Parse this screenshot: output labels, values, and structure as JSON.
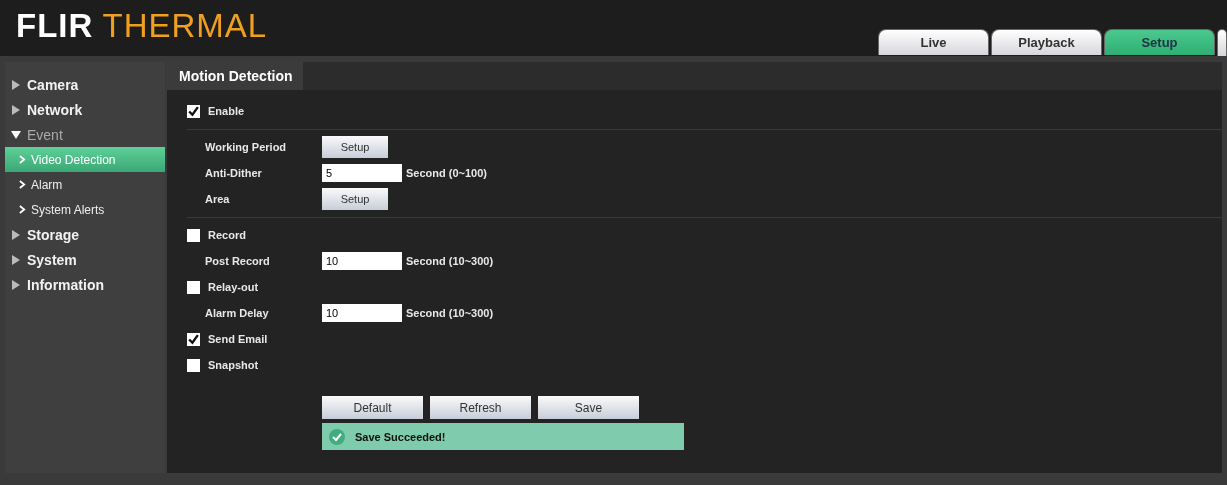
{
  "logo": {
    "bold": "FLIR",
    "light": "THERMAL"
  },
  "tabs": [
    {
      "label": "Live",
      "selected": false
    },
    {
      "label": "Playback",
      "selected": false
    },
    {
      "label": "Setup",
      "selected": true
    }
  ],
  "sidebar": {
    "items": [
      {
        "label": "Camera",
        "expanded": false,
        "selected": false
      },
      {
        "label": "Network",
        "expanded": false,
        "selected": false
      },
      {
        "label": "Event",
        "expanded": true,
        "selected": false,
        "children": [
          {
            "label": "Video Detection",
            "selected": true
          },
          {
            "label": "Alarm",
            "selected": false
          },
          {
            "label": "System Alerts",
            "selected": false
          }
        ]
      },
      {
        "label": "Storage",
        "expanded": false,
        "selected": false
      },
      {
        "label": "System",
        "expanded": false,
        "selected": false
      },
      {
        "label": "Information",
        "expanded": false,
        "selected": false
      }
    ]
  },
  "panel_tab": "Motion Detection",
  "rows": [
    {
      "kind": "checkbox",
      "label": "Enable",
      "checked": true,
      "divider": true
    },
    {
      "kind": "button",
      "label": "Working Period",
      "button": "Setup"
    },
    {
      "kind": "input",
      "label": "Anti-Dither",
      "value": "5",
      "unit": "Second (0~100)"
    },
    {
      "kind": "button",
      "label": "Area",
      "button": "Setup",
      "divider": true
    },
    {
      "kind": "checkbox",
      "label": "Record",
      "checked": false
    },
    {
      "kind": "input",
      "label": "Post Record",
      "value": "10",
      "unit": "Second (10~300)"
    },
    {
      "kind": "checkbox",
      "label": "Relay-out",
      "checked": false
    },
    {
      "kind": "input",
      "label": "Alarm Delay",
      "value": "10",
      "unit": "Second (10~300)"
    },
    {
      "kind": "checkbox",
      "label": "Send Email",
      "checked": true
    },
    {
      "kind": "checkbox",
      "label": "Snapshot",
      "checked": false
    }
  ],
  "buttons": [
    "Default",
    "Refresh",
    "Save"
  ],
  "status": "Save Succeeded!"
}
